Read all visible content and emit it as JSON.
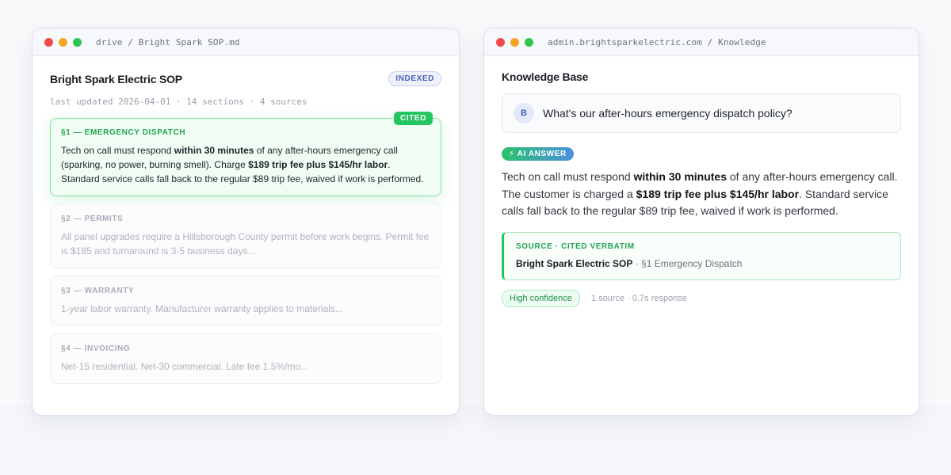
{
  "left_window": {
    "path": "drive / Bright Spark SOP.md",
    "doc_title": "Bright Spark Electric SOP",
    "badge": "INDEXED",
    "meta": "last updated 2026-04-01 · 14 sections · 4 sources",
    "cited_label": "CITED",
    "sections": [
      {
        "label": "§1 — EMERGENCY DISPATCH",
        "parts": [
          "Tech on call must respond ",
          "within 30 minutes",
          " of any after-hours emergency call (sparking, no power, burning smell). Charge ",
          "$189 trip fee plus $145/hr labor",
          ". Standard service calls fall back to the regular $89 trip fee, waived if work is performed."
        ]
      },
      {
        "label": "§2 — PERMITS",
        "body": "All panel upgrades require a Hillsborough County permit before work begins. Permit fee is $185 and turnaround is 3-5 business days..."
      },
      {
        "label": "§3 — WARRANTY",
        "body": "1-year labor warranty. Manufacturer warranty applies to materials..."
      },
      {
        "label": "§4 — INVOICING",
        "body": "Net-15 residential. Net-30 commercial. Late fee 1.5%/mo..."
      }
    ]
  },
  "right_window": {
    "path": "admin.brightsparkelectric.com / Knowledge",
    "title": "Knowledge Base",
    "avatar_letter": "B",
    "question": "What's our after-hours emergency dispatch policy?",
    "ai_badge": "⚡ AI ANSWER",
    "answer_parts": [
      "Tech on call must respond ",
      "within 30 minutes",
      " of any after-hours emergency call. The customer is charged a ",
      "$189 trip fee plus $145/hr labor",
      ". Standard service calls fall back to the regular $89 trip fee, waived if work is performed."
    ],
    "source_label": "SOURCE · CITED VERBATIM",
    "source_doc": "Bright Spark Electric SOP",
    "source_section": " · §1 Emergency Dispatch",
    "confidence": "High confidence",
    "foot_meta": "1 source · 0.7s response"
  },
  "colors": {
    "accent_green": "#22c55e",
    "accent_blue": "#4b5fb8",
    "dot_red": "#f04a46",
    "dot_yellow": "#f5a623",
    "dot_green": "#2dc653"
  }
}
